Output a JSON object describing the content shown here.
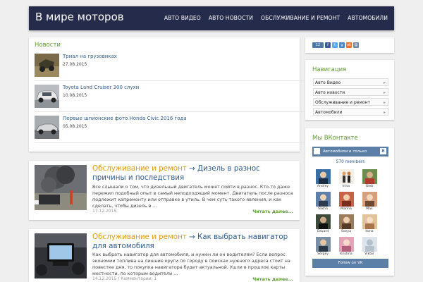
{
  "header": {
    "site_title": "В мире моторов",
    "nav": [
      "АВТО ВИДЕО",
      "АВТО НОВОСТИ",
      "ОБСЛУЖИВАНИЕ И РЕМОНТ",
      "АВТОМОБИЛИ"
    ]
  },
  "news": {
    "heading": "Новости",
    "items": [
      {
        "title": "Триал на грузовиках",
        "date": "27.08.2015"
      },
      {
        "title": "Toyota Land Cruiser 300 слухи",
        "date": "10.08.2015"
      },
      {
        "title": "Первые шпионские фото Honda Civic 2016 года",
        "date": "05.08.2015"
      }
    ]
  },
  "posts": [
    {
      "category": "Обслуживание и ремонт",
      "arrow": "→",
      "title": "Дизель в разнос причины и последствия",
      "excerpt": "Все слышали о том, что дизельный двигатель может пойти в разнос. Кто-то даже пережил подобный опыт в самый неподходящий момент. Двигатель после разноса подлежит капремонту или отправке в утиль. В чем суть такого явления, и как сделать, чтобы дизель в ...",
      "date": "17.12.2015",
      "read_more": "Читать далее..."
    },
    {
      "category": "Обслуживание и ремонт",
      "arrow": "→",
      "title": "Как выбрать навигатор для автомобиля",
      "excerpt": "Как выбрать навигатор для автомобиля, и нужен ли он водителям? Если вопрос экономии топлива на лишние круги по городу в поисках нужного адреса стоит на повестке дня, то покупка навигатора будет актуальной. Ушли в прошлое карты местности, по которым водители ...",
      "date": "14.12.2015 / Комментарии: 1",
      "read_more": "Читать далее..."
    }
  ],
  "social": {
    "buttons": [
      {
        "label": "12",
        "color": "#4b76a6"
      },
      {
        "label": "f",
        "color": "#3b5998"
      },
      {
        "label": "t",
        "color": "#55acee"
      },
      {
        "label": "g",
        "color": "#4a86c5"
      },
      {
        "label": "ok",
        "color": "#eb722e"
      },
      {
        "label": "@",
        "color": "#6d8aa9"
      }
    ]
  },
  "navigation": {
    "heading": "Навигация",
    "items": [
      "Авто Видео",
      "Авто новости",
      "Обслуживание и ремонт",
      "Автомобили"
    ]
  },
  "vk_widget": {
    "heading": "Мы ВКонтакте",
    "group_name": "Автомобили и только",
    "members": "570 members",
    "people": [
      "Andrey",
      "Irina",
      "Gleb",
      "Sasha",
      "Marina",
      "Max",
      "Eduard",
      "Sonya",
      "Ilona",
      "Sergey",
      "Kristina",
      "Viktor"
    ],
    "follow_label": "Follow on VK"
  },
  "colors": {
    "header_bg": "#252b4a",
    "accent_green": "#5a9b2b",
    "accent_orange": "#e39b1b",
    "link_blue": "#2d5a8f",
    "vk_blue": "#5b7fa6"
  }
}
